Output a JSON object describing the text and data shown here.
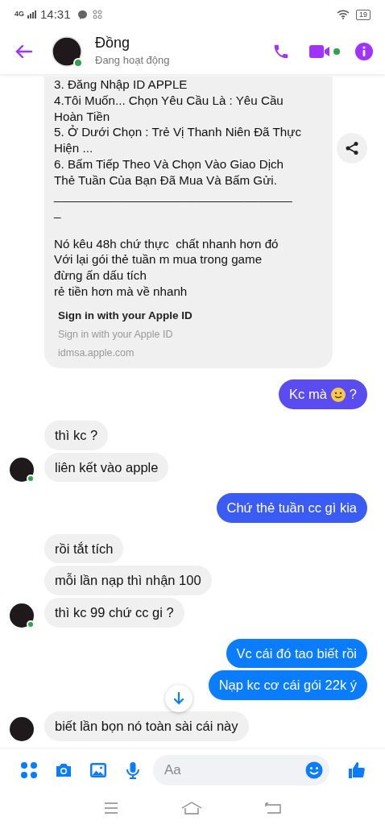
{
  "status_bar": {
    "network": "4G",
    "time": "14:31",
    "battery": "19"
  },
  "header": {
    "name": "Đồng",
    "status": "Đang hoạt động",
    "online": true
  },
  "messages": [
    {
      "kind": "incoming",
      "avatar": false,
      "text": "3. Đăng Nhập ID APPLE\n4.Tôi Muốn... Chọn Yêu Cầu Là : Yêu Cầu\nHoàn Tiền\n5. Ở Dưới Chọn : Trẻ Vị Thanh Niên Đã Thực\nHiện ...\n6. Bấm Tiếp Theo Và Chọn Vào Giao Dịch\nThẻ Tuần Của Bạn Đã Mua Và Bấm Gửi.\n___________________________________\n_\n\nNó kêu 48h chứ thực  chất nhanh hơn đó\nVới lại gói thẻ tuần m mua trong game\nđừng ấn dấu tích\nrẻ tiền hơn mà về nhanh",
      "link": {
        "title": "Sign in with your Apple ID",
        "subtitle": "Sign in with your Apple ID",
        "domain": "idmsa.apple.com"
      },
      "share": true
    },
    {
      "kind": "outgoing",
      "text": "Kc mà",
      "emoji": true,
      "suffix": "?",
      "color": "#5a4cf0"
    },
    {
      "kind": "incoming",
      "avatar": false,
      "text": "thì kc ?"
    },
    {
      "kind": "incoming",
      "avatar": true,
      "online": true,
      "text": "liên kết vào apple"
    },
    {
      "kind": "outgoing",
      "text": "Chứ thẻ tuần cc gì kia",
      "color": "#3a5cf5"
    },
    {
      "kind": "incoming",
      "avatar": false,
      "text": "rồi tắt tích"
    },
    {
      "kind": "incoming",
      "avatar": false,
      "text": "mỗi lần nạp thì nhận 100"
    },
    {
      "kind": "incoming",
      "avatar": true,
      "online": true,
      "text": "thì kc 99 chứ cc gi ?"
    },
    {
      "kind": "outgoing",
      "text": "Vc cái đó tao biết rồi",
      "color": "#0a7cff"
    },
    {
      "kind": "outgoing",
      "text": "Nạp kc cơ cái gói 22k ý",
      "color": "#0a7cff"
    },
    {
      "kind": "incoming",
      "avatar": true,
      "online": false,
      "text": "biết lần bọn nó toàn sài cái này"
    }
  ],
  "composer": {
    "placeholder": "Aa"
  }
}
